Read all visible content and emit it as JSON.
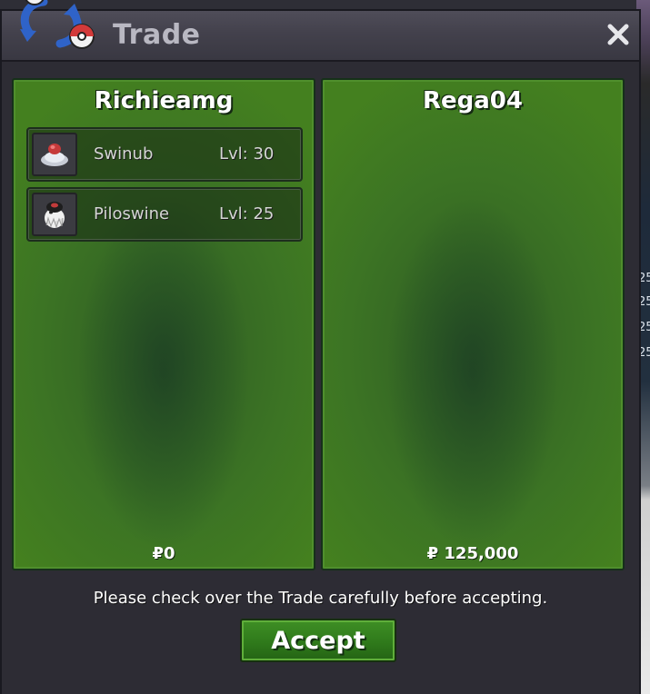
{
  "window": {
    "title": "Trade",
    "close_icon": "close-icon",
    "logo_icon": "trade-arrows-pokeball-icon"
  },
  "left_trader": {
    "name": "Richieamg",
    "items": [
      {
        "icon": "swinub-icon",
        "name": "Swinub",
        "level": "Lvl: 30"
      },
      {
        "icon": "piloswine-icon",
        "name": "Piloswine",
        "level": "Lvl: 25"
      }
    ],
    "money": "₽0"
  },
  "right_trader": {
    "name": "Rega04",
    "items": [],
    "money": "₽ 125,000"
  },
  "notice": "Please check over the Trade carefully before accepting.",
  "accept_label": "Accept",
  "background_numbers": [
    "25",
    "25",
    "25",
    "25"
  ],
  "colors": {
    "panel_green": "#3c7424",
    "accept_green": "#2f7a1b",
    "window_dark": "#2d2c34"
  }
}
